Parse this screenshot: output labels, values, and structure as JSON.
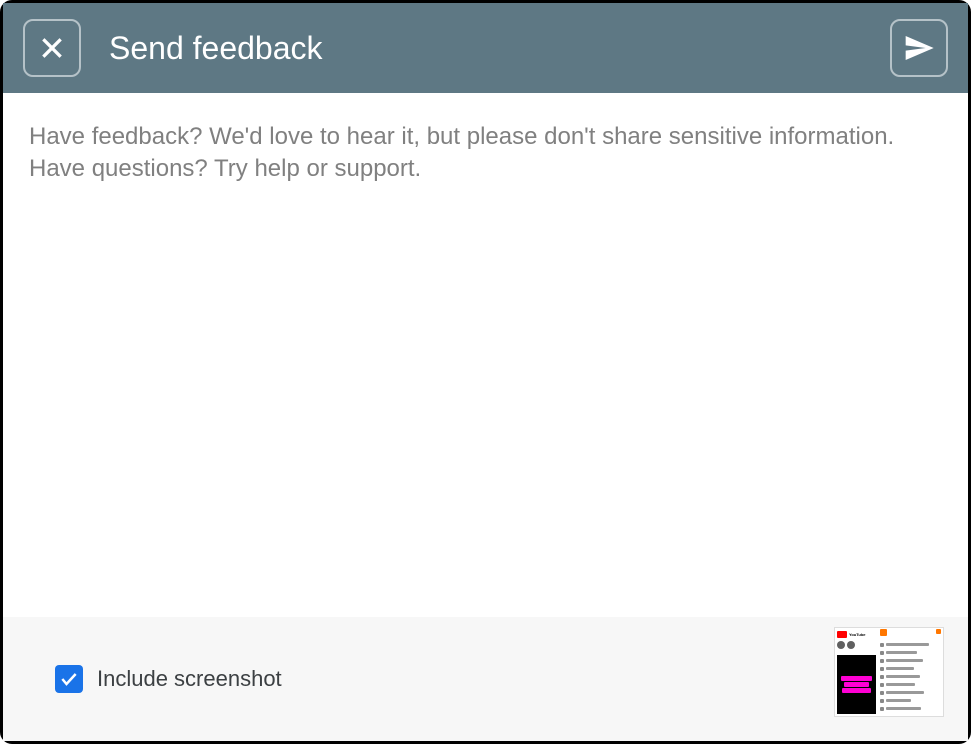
{
  "header": {
    "title": "Send feedback"
  },
  "feedback": {
    "placeholder": "Have feedback? We'd love to hear it, but please don't share sensitive information. Have questions? Try help or support.",
    "value": ""
  },
  "footer": {
    "include_screenshot_label": "Include screenshot",
    "include_screenshot_checked": true
  },
  "icons": {
    "close": "close-icon",
    "send": "send-icon",
    "check": "check-icon"
  }
}
